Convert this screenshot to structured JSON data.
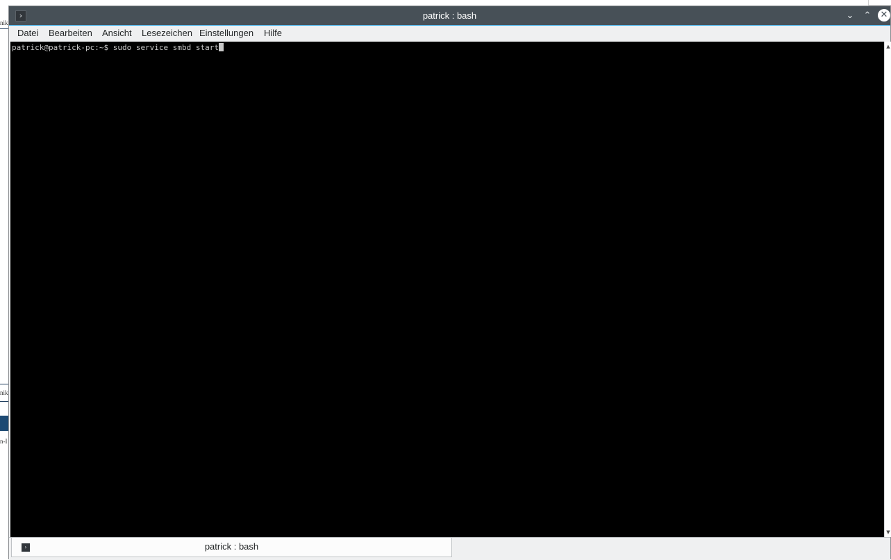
{
  "background": {
    "fragments": [
      "nik",
      "nik",
      "",
      "n-I"
    ]
  },
  "window": {
    "title": "patrick : bash",
    "icons": {
      "app": "terminal-icon",
      "minimize": "chevron-down-icon",
      "maximize": "chevron-up-icon",
      "close": "close-icon"
    },
    "glyphs": {
      "app": "›",
      "minimize": "⌄",
      "maximize": "⌃",
      "close": "✕"
    }
  },
  "menubar": {
    "items": [
      "Datei",
      "Bearbeiten",
      "Ansicht",
      "Lesezeichen",
      "Einstellungen",
      "Hilfe"
    ]
  },
  "terminal": {
    "prompt": "patrick@patrick-pc:~$ ",
    "command": "sudo service smbd start"
  },
  "scrollbar": {
    "up_glyph": "▲",
    "down_glyph": "▼"
  },
  "tabs": [
    {
      "label": "patrick : bash",
      "icon": "terminal-icon",
      "glyph": "›"
    }
  ],
  "colors": {
    "titlebar": "#475057",
    "accent": "#3daee9",
    "terminal_bg": "#000000",
    "terminal_fg": "#c8c8c8"
  }
}
